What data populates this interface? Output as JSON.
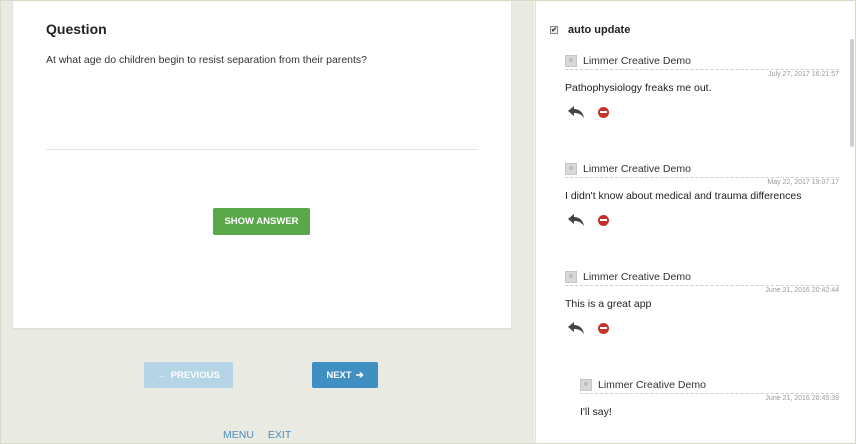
{
  "question": {
    "heading": "Question",
    "text": "At what age do children begin to resist separation from their parents?",
    "show_answer_label": "SHOW ANSWER"
  },
  "navigation": {
    "previous_label": "PREVIOUS",
    "next_label": "NEXT",
    "menu_label": "MENU",
    "exit_label": "EXIT"
  },
  "comments_panel": {
    "auto_update_label": "auto update",
    "auto_update_checked": true,
    "comments": [
      {
        "author": "Limmer Creative Demo",
        "date": "July 27, 2017 16:21:57",
        "text": "Pathophysiology freaks me out."
      },
      {
        "author": "Limmer Creative Demo",
        "date": "May 22, 2017 19:07:17",
        "text": "I didn't know about medical and trauma differences"
      },
      {
        "author": "Limmer Creative Demo",
        "date": "June 21, 2016 20:42:44",
        "text": "This is a great app"
      },
      {
        "author": "Limmer Creative Demo",
        "date": "June 21, 2016 20:45:39",
        "text": "I'll say!"
      }
    ]
  },
  "colors": {
    "show_answer_bg": "#5aa84a",
    "next_bg": "#3f8fc2",
    "previous_bg": "#b5d5e6",
    "delete_icon": "#c3332c",
    "link": "#4a8cbf"
  }
}
